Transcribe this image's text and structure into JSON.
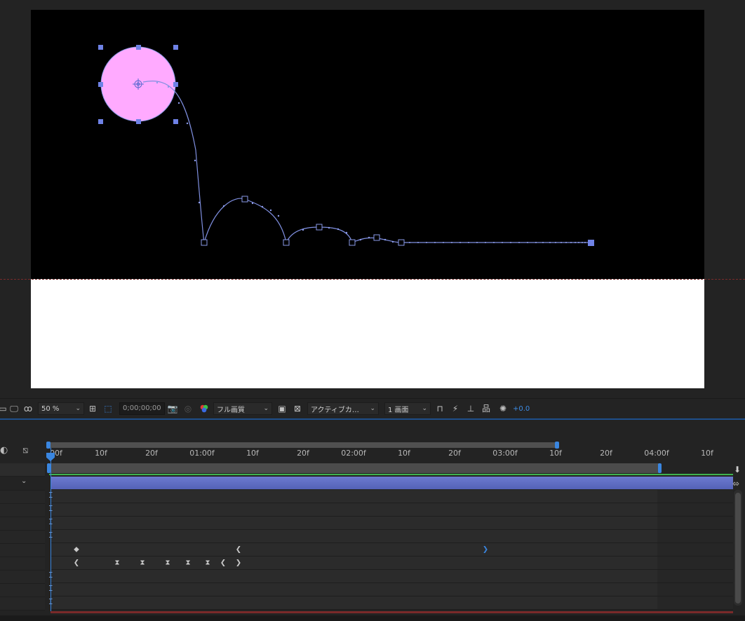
{
  "toolbar": {
    "zoom": "50 %",
    "timecode": "0;00;00;00",
    "resolution": "フル画質",
    "camera_view": "アクティブカ…",
    "views": "1 画面",
    "exposure": "+0.0"
  },
  "ruler": {
    "ticks": [
      "00f",
      "10f",
      "20f",
      "01:00f",
      "10f",
      "20f",
      "02:00f",
      "10f",
      "20f",
      "03:00f",
      "10f",
      "20f",
      "04:00f",
      "10f"
    ]
  },
  "colors": {
    "accent": "#3a86e0",
    "layer_bar": "#5f6dc4",
    "ball_fill": "#ffaaff",
    "path": "#8a9ae8"
  },
  "icons": {
    "mask": "mask-icon",
    "monitor": "monitor-icon",
    "snapshot": "camera-icon",
    "color": "rgb-channels-icon",
    "region": "region-icon",
    "transparency": "transparency-grid-icon",
    "reset_exposure": "exposure-icon"
  }
}
